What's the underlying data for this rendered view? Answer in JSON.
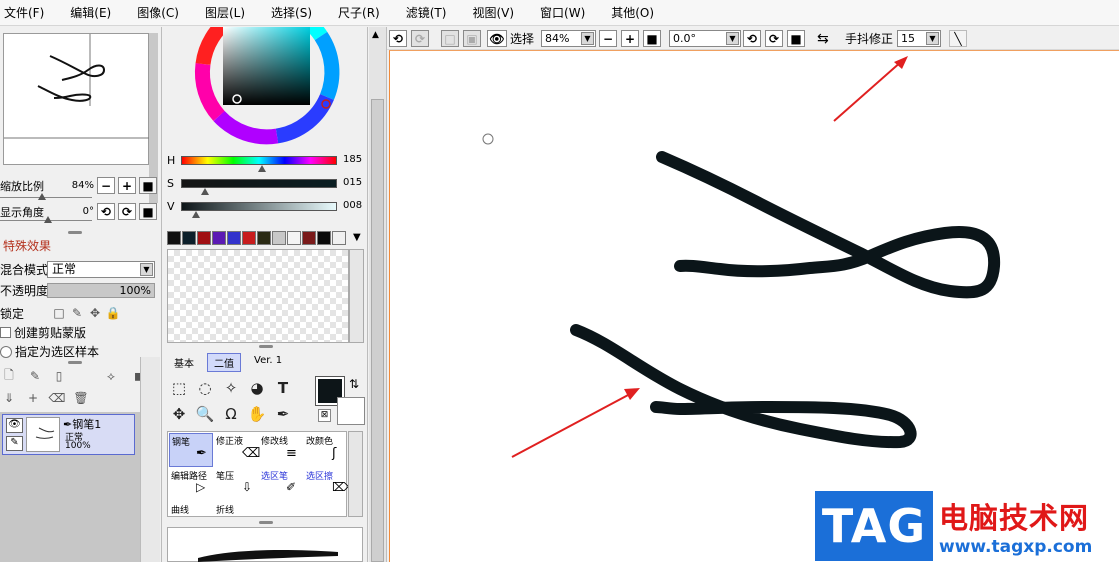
{
  "menu": [
    {
      "label": "文件(F)"
    },
    {
      "label": "编辑(E)"
    },
    {
      "label": "图像(C)"
    },
    {
      "label": "图层(L)"
    },
    {
      "label": "选择(S)"
    },
    {
      "label": "尺子(R)"
    },
    {
      "label": "滤镜(T)"
    },
    {
      "label": "视图(V)"
    },
    {
      "label": "窗口(W)"
    },
    {
      "label": "其他(O)"
    }
  ],
  "navigator": {
    "zoom_label": "缩放比例",
    "zoom_value": "84%",
    "angle_label": "显示角度",
    "angle_value": "0°"
  },
  "layer_panel": {
    "effects_label": "特殊效果",
    "blend_label": "混合模式",
    "blend_value": "正常",
    "opacity_label": "不透明度",
    "opacity_value": "100%",
    "lock_label": "锁定",
    "clipping_label": "创建剪贴蒙版",
    "selection_source_label": "指定为选区样本",
    "layer": {
      "name": "钢笔1",
      "mode": "正常",
      "opacity": "100%"
    }
  },
  "color": {
    "h_label": "H",
    "h_value": "185",
    "s_label": "S",
    "s_value": "015",
    "v_label": "V",
    "v_value": "008",
    "main": "#0d1518",
    "sub": "#ffffff",
    "swatches": [
      "#101010",
      "#0c1f2a",
      "#a00f12",
      "#5b1ab4",
      "#3333cc",
      "#c81c1c",
      "#2a2a14",
      "#c8c8c8",
      "#f4f4f4",
      "#7a1a1a",
      "#0a0a0a",
      "#f0f0f0"
    ]
  },
  "tool_tabs": [
    {
      "label": "基本"
    },
    {
      "label": "二值"
    },
    {
      "label": "Ver. 1"
    }
  ],
  "brushes": [
    {
      "label": "钢笔"
    },
    {
      "label": "修正液"
    },
    {
      "label": "修改线"
    },
    {
      "label": "改颜色"
    },
    {
      "label": "编辑路径"
    },
    {
      "label": "笔压"
    },
    {
      "label": "选区笔"
    },
    {
      "label": "选区擦"
    },
    {
      "label": "曲线"
    },
    {
      "label": "折线"
    }
  ],
  "toolbar": {
    "select_label": "选择",
    "zoom_value": "84%",
    "angle_value": "0.0°",
    "stabilizer_label": "手抖修正",
    "stabilizer_value": "15"
  },
  "watermark": {
    "tag": "TAG",
    "title": "电脑技术网",
    "url": "www.tagxp.com"
  }
}
